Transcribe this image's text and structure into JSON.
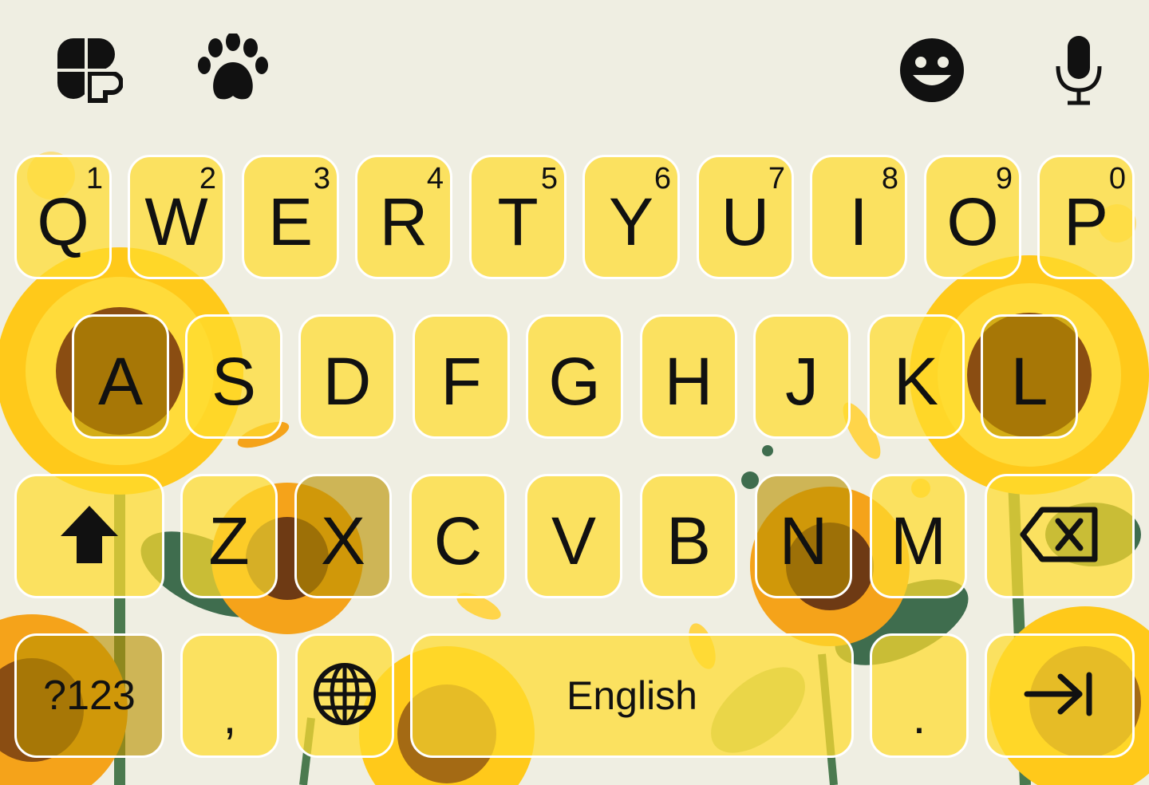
{
  "toolbar": {
    "left": [
      {
        "name": "clover-icon"
      },
      {
        "name": "paw-icon"
      }
    ],
    "right": [
      {
        "name": "emoji-icon"
      },
      {
        "name": "microphone-icon"
      }
    ]
  },
  "rows": {
    "row1": [
      {
        "key": "Q",
        "hint": "1"
      },
      {
        "key": "W",
        "hint": "2"
      },
      {
        "key": "E",
        "hint": "3"
      },
      {
        "key": "R",
        "hint": "4"
      },
      {
        "key": "T",
        "hint": "5"
      },
      {
        "key": "Y",
        "hint": "6"
      },
      {
        "key": "U",
        "hint": "7"
      },
      {
        "key": "I",
        "hint": "8"
      },
      {
        "key": "O",
        "hint": "9"
      },
      {
        "key": "P",
        "hint": "0"
      }
    ],
    "row2": [
      {
        "key": "A"
      },
      {
        "key": "S"
      },
      {
        "key": "D"
      },
      {
        "key": "F"
      },
      {
        "key": "G"
      },
      {
        "key": "H"
      },
      {
        "key": "J"
      },
      {
        "key": "K"
      },
      {
        "key": "L"
      }
    ],
    "row3": [
      {
        "key": "Z"
      },
      {
        "key": "X"
      },
      {
        "key": "C"
      },
      {
        "key": "V"
      },
      {
        "key": "B"
      },
      {
        "key": "N"
      },
      {
        "key": "M"
      }
    ]
  },
  "bottom": {
    "symbols_label": "?123",
    "comma": ",",
    "space_label": "English",
    "period": "."
  },
  "colors": {
    "background": "#efeee2",
    "key_fill": "#ffdd2e",
    "key_border": "#ffffff",
    "text": "#111111"
  }
}
